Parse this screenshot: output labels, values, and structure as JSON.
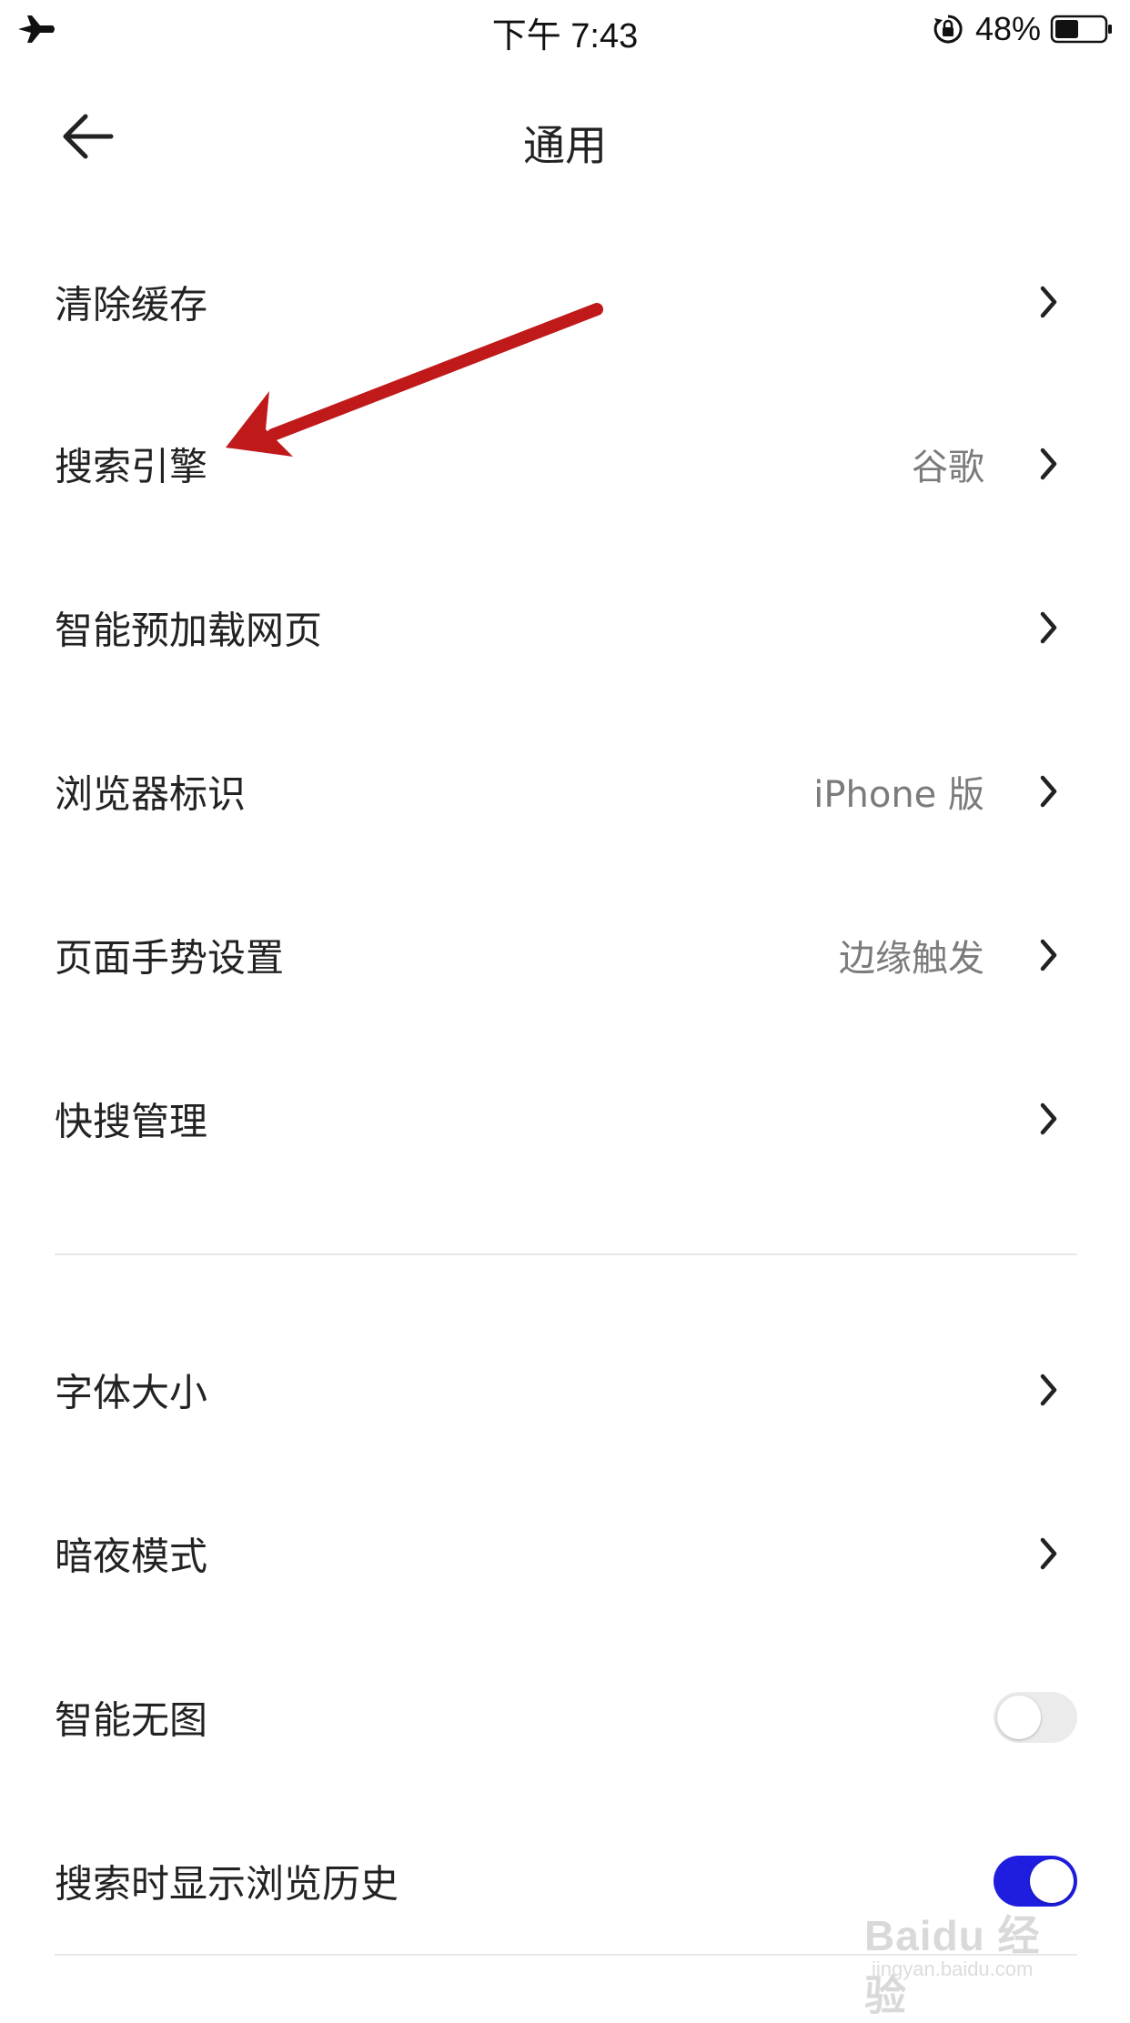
{
  "status_bar": {
    "time": "下午 7:43",
    "battery_percent": "48%",
    "battery_level": 0.48,
    "icons": [
      "airplane-icon",
      "rotation-lock-icon",
      "battery-icon"
    ]
  },
  "header": {
    "title": "通用",
    "back_icon": "back-arrow-icon"
  },
  "settings": {
    "group1": [
      {
        "label": "清除缓存",
        "value": ""
      },
      {
        "label": "搜索引擎",
        "value": "谷歌"
      },
      {
        "label": "智能预加载网页",
        "value": ""
      },
      {
        "label": "浏览器标识",
        "value": "iPhone 版"
      },
      {
        "label": "页面手势设置",
        "value": "边缘触发"
      },
      {
        "label": "快搜管理",
        "value": ""
      }
    ],
    "group2": [
      {
        "label": "字体大小",
        "value": ""
      },
      {
        "label": "暗夜模式",
        "value": ""
      },
      {
        "label": "智能无图",
        "toggle": false
      },
      {
        "label": "搜索时显示浏览历史",
        "toggle": true
      }
    ]
  },
  "annotation": {
    "arrow_color": "#c0191a",
    "points_to": "搜索引擎"
  },
  "watermark": {
    "brand": "Baidu 经验",
    "url": "jingyan.baidu.com"
  },
  "colors": {
    "toggle_on": "#1f1ee0",
    "toggle_off": "#ebebeb",
    "value_text": "#7b7b7b"
  }
}
